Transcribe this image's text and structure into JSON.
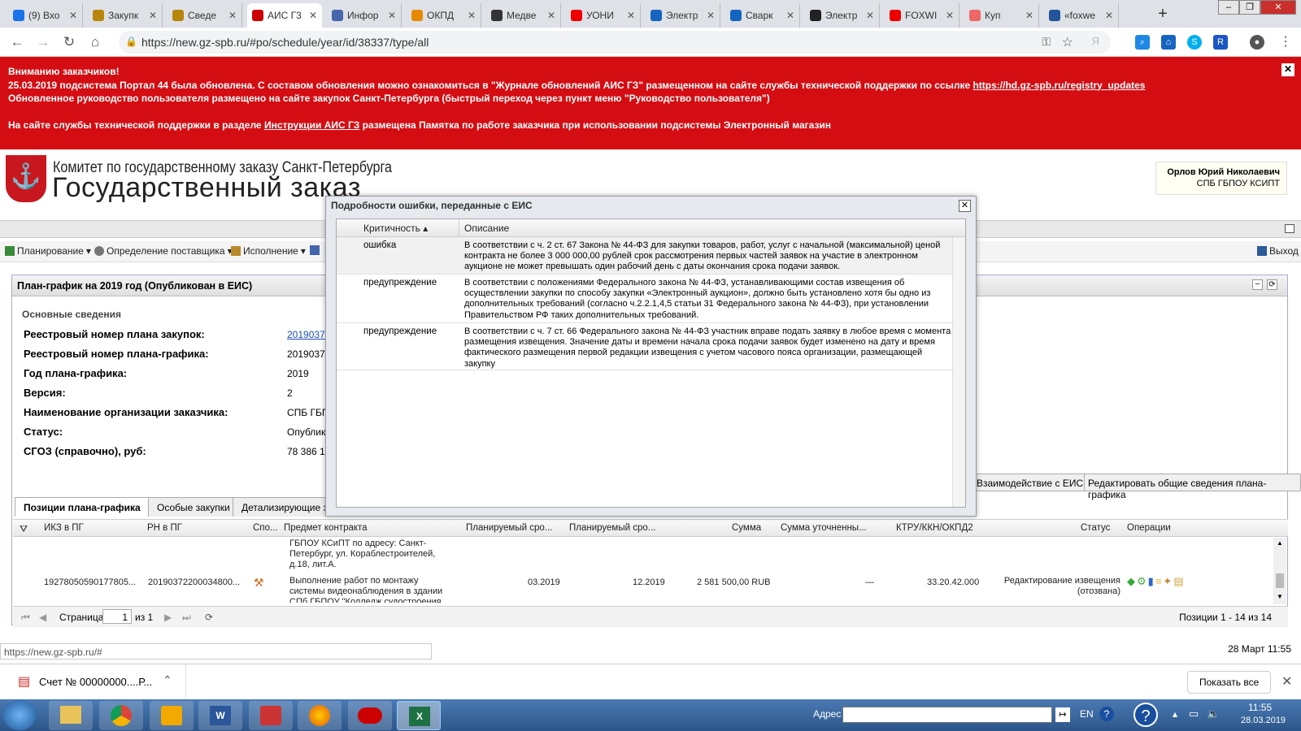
{
  "browser": {
    "tabs": [
      {
        "label": "(9) Вхо",
        "color": "#1a73e8"
      },
      {
        "label": "Закупк",
        "color": "#b8860b"
      },
      {
        "label": "Сведе",
        "color": "#b8860b"
      },
      {
        "label": "АИС Г3",
        "color": "#c00"
      },
      {
        "label": "Инфор",
        "color": "#4466aa"
      },
      {
        "label": "ОКПД",
        "color": "#e58a00"
      },
      {
        "label": "Медве",
        "color": "#333"
      },
      {
        "label": "УОНИ",
        "color": "#e00"
      },
      {
        "label": "Электр",
        "color": "#1565c0"
      },
      {
        "label": "Сварк",
        "color": "#1565c0"
      },
      {
        "label": "Электр",
        "color": "#222"
      },
      {
        "label": "FOXWI",
        "color": "#e00"
      },
      {
        "label": "Куп",
        "color": "#e66"
      },
      {
        "label": "«foxwe",
        "color": "#225599"
      }
    ],
    "url": "https://new.gz-spb.ru/#po/schedule/year/id/38337/type/all"
  },
  "banner": {
    "line1": "Вниманию заказчиков!",
    "line2": "25.03.2019 подсистема Портал 44 была обновлена. С составом обновления можно ознакомиться в \"Журнале обновлений АИС ГЗ\" размещенном на сайте службы технической поддержки по ссылке ",
    "link1": "https://hd.gz-spb.ru/registry_updates",
    "line3": "Обновленное руководство пользователя размещено на сайте закупок Санкт-Петербурга (быстрый переход через пункт меню \"Руководство пользователя\")",
    "line4_pre": "На сайте службы технической поддержки в разделе ",
    "link2": "Инструкции АИС ГЗ",
    "line4_post": " размещена Памятка по работе заказчика при использовании подсистемы Электронный магазин"
  },
  "header": {
    "org_line1": "Комитет по государственному заказу Санкт-Петербурга",
    "org_line2": "Государственный заказ",
    "user_name": "Орлов Юрий Николаевич",
    "user_org": "СПБ ГБПОУ КСИПТ"
  },
  "menu": {
    "items": [
      "Планирование",
      "Определение поставщика",
      "Исполнение"
    ],
    "exit": "Выход"
  },
  "panel": {
    "title": "План-график на 2019 год (Опубликован в ЕИС)",
    "section": "Основные сведения",
    "fields": [
      {
        "label": "Реестровый номер плана закупок:",
        "value": "2019037"
      },
      {
        "label": "Реестровый номер плана-графика:",
        "value": "2019037"
      },
      {
        "label": "Год плана-графика:",
        "value": "2019"
      },
      {
        "label": "Версия:",
        "value": "2"
      },
      {
        "label": "Наименование организации заказчика:",
        "value": "СПБ ГБП"
      },
      {
        "label": "Статус:",
        "value": "Опублик"
      },
      {
        "label": "СГОЗ (справочно), руб:",
        "value": "78 386 1"
      }
    ],
    "buttons": [
      "Взаимодействие с ЕИС",
      "Редактировать общие сведения плана-графика"
    ],
    "tabs": [
      "Позиции плана-графика",
      "Особые закупки",
      "Детализирующие за"
    ]
  },
  "grid": {
    "headers": [
      "ИКЗ в ПГ",
      "РН в ПГ",
      "Спо...",
      "Предмет контракта",
      "Планируемый сро...",
      "Планируемый сро...",
      "Сумма",
      "Сумма уточненны...",
      "КТРУ/ККН/ОКПД2",
      "Статус",
      "Операции"
    ],
    "partial_row": "ГБПОУ КСиПТ по адресу: Санкт-Петербург, ул. Кораблестроителей, д.18, лит.А.",
    "row": {
      "ikz": "19278050590177805...",
      "rn": "20190372200034800...",
      "subject": "Выполнение работ по монтажу системы видеонаблюдения в здании СПб ГБПОУ \"Колледж судостроения и",
      "start": "03.2019",
      "end": "12.2019",
      "sum": "2 581 500,00 RUB",
      "sum_adj": "—",
      "okpd": "33.20.42.000",
      "status": "Редактирование извещения (отозвана)"
    },
    "pager": {
      "page_label": "Страница",
      "page": "1",
      "of": "из 1",
      "summary": "Позиции 1 - 14 из 14"
    }
  },
  "dialog": {
    "title": "Подробности ошибки, переданные с ЕИС",
    "col_severity": "Критичность",
    "col_description": "Описание",
    "rows": [
      {
        "severity": "ошибка",
        "description": "В соответствии с ч. 2 ст. 67 Закона № 44-ФЗ для закупки товаров, работ, услуг с начальной (максимальной) ценой контракта не более 3 000 000,00 рублей срок рассмотрения первых частей заявок на участие в электронном аукционе не может превышать один рабочий день с даты окончания срока подачи заявок."
      },
      {
        "severity": "предупреждение",
        "description": "В соответствии с положениями Федерального закона № 44-ФЗ, устанавливающими состав извещения об осуществлении закупки по способу закупки «Электронный аукцион», должно быть установлено хотя бы одно из дополнительных требований (согласно ч.2.2.1,4,5 статьи 31 Федерального закона № 44-ФЗ), при установлении Правительством РФ таких дополнительных требований."
      },
      {
        "severity": "предупреждение",
        "description": "В соответствии с ч. 7 ст. 66 Федерального закона № 44-ФЗ участник вправе подать заявку в любое время с момента размещения извещения. Значение даты и времени начала срока подачи заявок будет изменено на дату и время фактического размещения первой редакции извещения с учетом часового пояса организации, размещающей закупку"
      }
    ]
  },
  "status": {
    "url": "https://new.gz-spb.ru/#",
    "datetime": "28 Март 11:55"
  },
  "downloads": {
    "file": "Счет № 00000000....Р...",
    "show_all": "Показать все"
  },
  "taskbar": {
    "address_label": "Адрес",
    "lang": "EN",
    "time": "11:55",
    "date": "28.03.2019"
  }
}
